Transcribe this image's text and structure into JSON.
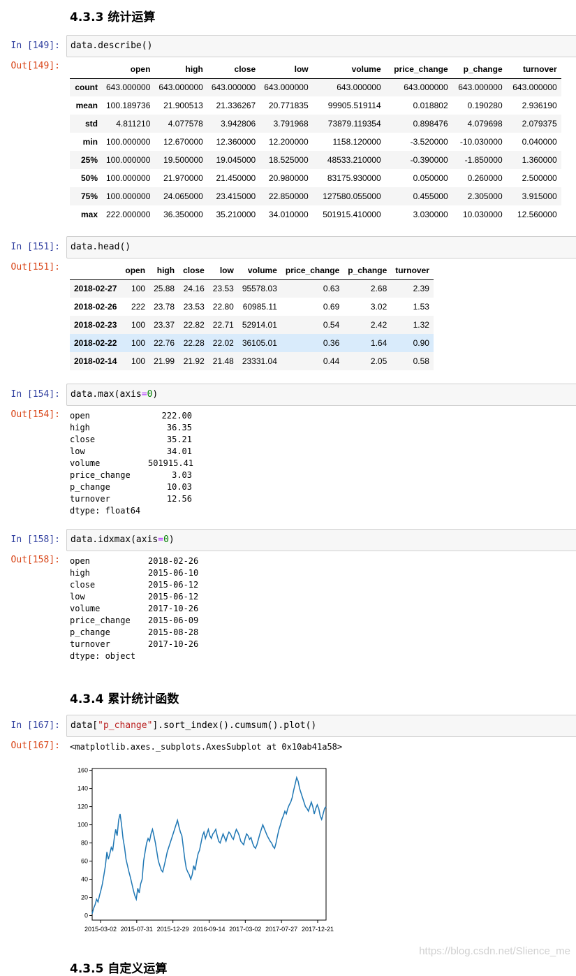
{
  "sections": {
    "s433": "4.3.3 统计运算",
    "s434": "4.3.4 累计统计函数",
    "s435": "4.3.5 自定义运算"
  },
  "cells": {
    "c149": {
      "in": "In  [149]:",
      "out": "Out[149]:",
      "code": "data.describe()"
    },
    "c151": {
      "in": "In  [151]:",
      "out": "Out[151]:",
      "code": "data.head()"
    },
    "c154": {
      "in": "In  [154]:",
      "out": "Out[154]:",
      "code_a": "data.max(axis",
      "code_op": "=",
      "code_num": "0",
      "code_b": ")"
    },
    "c158": {
      "in": "In  [158]:",
      "out": "Out[158]:",
      "code_a": "data.idxmax(axis",
      "code_op": "=",
      "code_num": "0",
      "code_b": ")"
    },
    "c167": {
      "in": "In  [167]:",
      "out": "Out[167]:",
      "code_a": "data[",
      "code_str": "\"p_change\"",
      "code_b": "].sort_index().cumsum().plot()",
      "out_text": "<matplotlib.axes._subplots.AxesSubplot at 0x10ab41a58>"
    }
  },
  "describe": {
    "columns": [
      "open",
      "high",
      "close",
      "low",
      "volume",
      "price_change",
      "p_change",
      "turnover"
    ],
    "rows": [
      {
        "label": "count",
        "values": [
          "643.000000",
          "643.000000",
          "643.000000",
          "643.000000",
          "643.000000",
          "643.000000",
          "643.000000",
          "643.000000"
        ]
      },
      {
        "label": "mean",
        "values": [
          "100.189736",
          "21.900513",
          "21.336267",
          "20.771835",
          "99905.519114",
          "0.018802",
          "0.190280",
          "2.936190"
        ]
      },
      {
        "label": "std",
        "values": [
          "4.811210",
          "4.077578",
          "3.942806",
          "3.791968",
          "73879.119354",
          "0.898476",
          "4.079698",
          "2.079375"
        ]
      },
      {
        "label": "min",
        "values": [
          "100.000000",
          "12.670000",
          "12.360000",
          "12.200000",
          "1158.120000",
          "-3.520000",
          "-10.030000",
          "0.040000"
        ]
      },
      {
        "label": "25%",
        "values": [
          "100.000000",
          "19.500000",
          "19.045000",
          "18.525000",
          "48533.210000",
          "-0.390000",
          "-1.850000",
          "1.360000"
        ]
      },
      {
        "label": "50%",
        "values": [
          "100.000000",
          "21.970000",
          "21.450000",
          "20.980000",
          "83175.930000",
          "0.050000",
          "0.260000",
          "2.500000"
        ]
      },
      {
        "label": "75%",
        "values": [
          "100.000000",
          "24.065000",
          "23.415000",
          "22.850000",
          "127580.055000",
          "0.455000",
          "2.305000",
          "3.915000"
        ]
      },
      {
        "label": "max",
        "values": [
          "222.000000",
          "36.350000",
          "35.210000",
          "34.010000",
          "501915.410000",
          "3.030000",
          "10.030000",
          "12.560000"
        ]
      }
    ]
  },
  "head": {
    "columns": [
      "open",
      "high",
      "close",
      "low",
      "volume",
      "price_change",
      "p_change",
      "turnover"
    ],
    "rows": [
      {
        "label": "2018-02-27",
        "values": [
          "100",
          "25.88",
          "24.16",
          "23.53",
          "95578.03",
          "0.63",
          "2.68",
          "2.39"
        ]
      },
      {
        "label": "2018-02-26",
        "values": [
          "222",
          "23.78",
          "23.53",
          "22.80",
          "60985.11",
          "0.69",
          "3.02",
          "1.53"
        ]
      },
      {
        "label": "2018-02-23",
        "values": [
          "100",
          "23.37",
          "22.82",
          "22.71",
          "52914.01",
          "0.54",
          "2.42",
          "1.32"
        ]
      },
      {
        "label": "2018-02-22",
        "values": [
          "100",
          "22.76",
          "22.28",
          "22.02",
          "36105.01",
          "0.36",
          "1.64",
          "0.90"
        ]
      },
      {
        "label": "2018-02-14",
        "values": [
          "100",
          "21.99",
          "21.92",
          "21.48",
          "23331.04",
          "0.44",
          "2.05",
          "0.58"
        ]
      }
    ]
  },
  "max_out": {
    "rows": [
      {
        "k": "open",
        "v": "222.00"
      },
      {
        "k": "high",
        "v": "36.35"
      },
      {
        "k": "close",
        "v": "35.21"
      },
      {
        "k": "low",
        "v": "34.01"
      },
      {
        "k": "volume",
        "v": "501915.41"
      },
      {
        "k": "price_change",
        "v": "3.03"
      },
      {
        "k": "p_change",
        "v": "10.03"
      },
      {
        "k": "turnover",
        "v": "12.56"
      }
    ],
    "dtype": "dtype: float64"
  },
  "idxmax_out": {
    "rows": [
      {
        "k": "open",
        "v": "2018-02-26"
      },
      {
        "k": "high",
        "v": "2015-06-10"
      },
      {
        "k": "close",
        "v": "2015-06-12"
      },
      {
        "k": "low",
        "v": "2015-06-12"
      },
      {
        "k": "volume",
        "v": "2017-10-26"
      },
      {
        "k": "price_change",
        "v": "2015-06-09"
      },
      {
        "k": "p_change",
        "v": "2015-08-28"
      },
      {
        "k": "turnover",
        "v": "2017-10-26"
      }
    ],
    "dtype": "dtype: object"
  },
  "chart_data": {
    "type": "line",
    "title": "",
    "xlabel": "",
    "ylabel": "",
    "x_ticks": [
      "2015-03-02",
      "2015-07-31",
      "2015-12-29",
      "2016-09-14",
      "2017-03-02",
      "2017-07-27",
      "2017-12-21"
    ],
    "y_ticks": [
      0,
      20,
      40,
      60,
      80,
      100,
      120,
      140,
      160
    ],
    "ylim": [
      -5,
      162
    ],
    "color": "#1f77b4",
    "series": [
      {
        "values": [
          2,
          8,
          12,
          18,
          15,
          22,
          28,
          35,
          45,
          55,
          70,
          62,
          68,
          75,
          72,
          85,
          95,
          88,
          105,
          112,
          100,
          85,
          75,
          62,
          55,
          48,
          42,
          35,
          28,
          22,
          18,
          30,
          25,
          35,
          40,
          60,
          70,
          80,
          85,
          82,
          90,
          95,
          88,
          80,
          70,
          60,
          55,
          50,
          48,
          55,
          62,
          70,
          75,
          80,
          85,
          90,
          95,
          100,
          105,
          98,
          92,
          88,
          75,
          62,
          52,
          48,
          45,
          40,
          45,
          55,
          50,
          60,
          68,
          72,
          80,
          88,
          92,
          85,
          90,
          95,
          88,
          85,
          90,
          92,
          95,
          88,
          82,
          80,
          85,
          90,
          86,
          82,
          88,
          92,
          90,
          86,
          84,
          90,
          95,
          92,
          88,
          82,
          80,
          78,
          85,
          90,
          88,
          84,
          86,
          80,
          76,
          74,
          78,
          84,
          90,
          95,
          100,
          96,
          92,
          88,
          85,
          82,
          80,
          76,
          74,
          80,
          88,
          95,
          100,
          106,
          110,
          115,
          112,
          118,
          122,
          125,
          130,
          138,
          145,
          152,
          148,
          140,
          135,
          130,
          125,
          120,
          118,
          115,
          120,
          125,
          120,
          112,
          118,
          122,
          118,
          110,
          106,
          112,
          118,
          120
        ]
      }
    ]
  },
  "watermark": "https://blog.csdn.net/Slience_me"
}
